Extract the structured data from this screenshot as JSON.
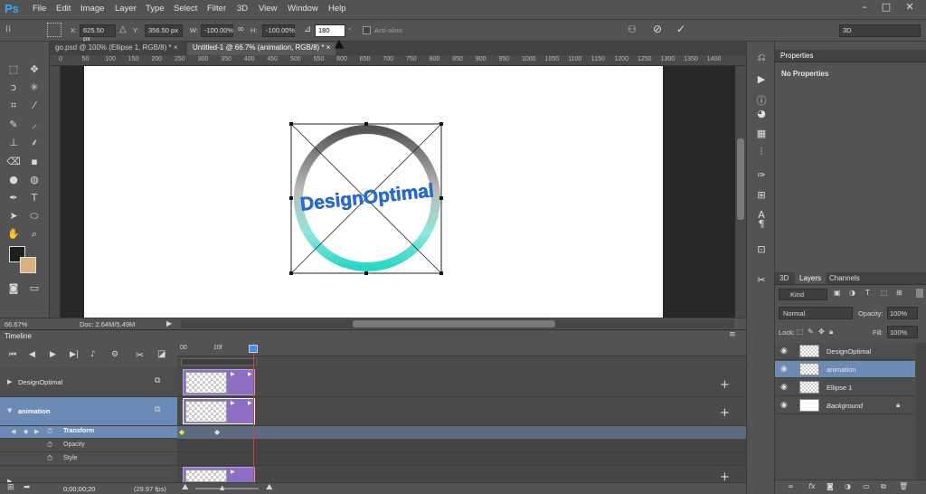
{
  "app": {
    "logo": "Ps"
  },
  "menu": [
    "File",
    "Edit",
    "Image",
    "Layer",
    "Type",
    "Select",
    "Filter",
    "3D",
    "View",
    "Window",
    "Help"
  ],
  "window_controls": {
    "minimize": "–",
    "maximize": "□",
    "close": "✕"
  },
  "options": {
    "x_label": "X:",
    "x_value": "625.50 px",
    "y_label": "Y:",
    "y_value": "356.50 px",
    "w_label": "W:",
    "w_value": "-100.00%",
    "h_label": "H:",
    "h_value": "-100.00%",
    "angle_value": "180",
    "angle_unit": "°",
    "antialias_label": "Anti-alias",
    "workspace": "3D"
  },
  "doc_tabs": [
    {
      "label": "go.psd @ 100% (Ellipse 1, RGB/8) *",
      "close": "×"
    },
    {
      "label": "Untitled-1 @ 66.7% (animation, RGB/8) *",
      "close": "×"
    }
  ],
  "ruler_ticks": [
    "0",
    "50",
    "100",
    "150",
    "200",
    "250",
    "300",
    "350",
    "400",
    "450",
    "500",
    "550",
    "600",
    "650",
    "700",
    "750",
    "800",
    "850",
    "900",
    "950",
    "1000",
    "1050",
    "1100",
    "1150",
    "1200",
    "1250",
    "1300",
    "1350",
    "1400"
  ],
  "canvas": {
    "logo_text": "DesignOptimal"
  },
  "status": {
    "zoom": "66.67%",
    "doc": "Doc: 2.64M/5.49M"
  },
  "timeline": {
    "title": "Timeline",
    "ruler": [
      "00",
      "10f"
    ],
    "layers": [
      {
        "name": "DesignOptimal"
      },
      {
        "name": "animation"
      }
    ],
    "properties": [
      "Transform",
      "Opacity",
      "Style"
    ],
    "timecode": "0;00;00;20",
    "fps": "(29.97 fps)"
  },
  "properties_panel": {
    "title": "Properties",
    "content": "No Properties"
  },
  "layers_panel": {
    "tabs": [
      "3D",
      "Layers",
      "Channels"
    ],
    "filter": "Kind",
    "blend_mode": "Normal",
    "opacity_label": "Opacity:",
    "opacity_value": "100%",
    "lock_label": "Lock:",
    "fill_label": "Fill:",
    "fill_value": "100%",
    "layers": [
      {
        "name": "DesignOptimal"
      },
      {
        "name": "animation"
      },
      {
        "name": "Ellipse 1"
      },
      {
        "name": "Background"
      }
    ]
  },
  "colors": {
    "accent_blue": "#31a8ff",
    "clip_purple": "#8c6ec4",
    "selected_row": "#6b8ab5",
    "playhead": "#d04040"
  }
}
